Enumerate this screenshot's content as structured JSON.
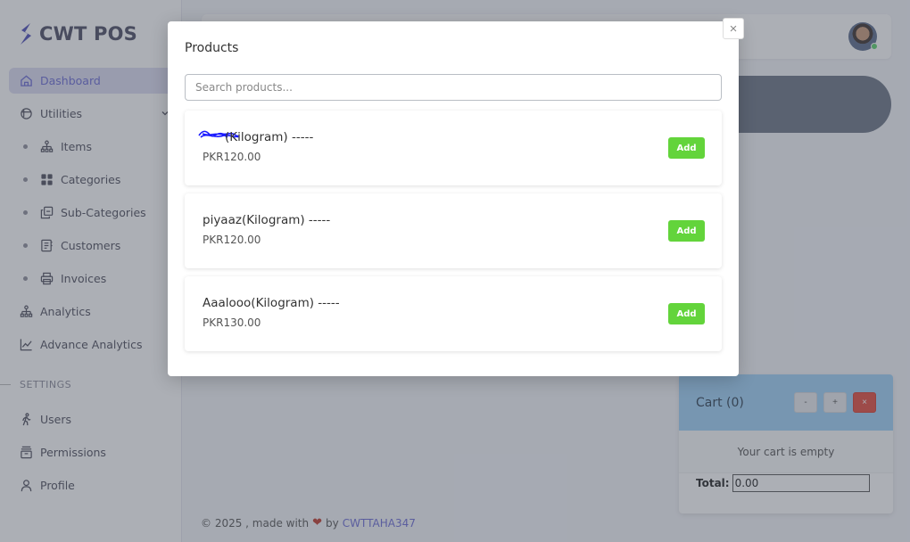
{
  "app": {
    "name": "CWT POS"
  },
  "sidebar": {
    "items": [
      {
        "label": "Dashboard",
        "icon": "home-icon",
        "active": true
      },
      {
        "label": "Utilities",
        "icon": "box-icon"
      },
      {
        "label": "Items",
        "icon": "sitemap-icon"
      },
      {
        "label": "Categories",
        "icon": "grid-icon"
      },
      {
        "label": "Sub-Categories",
        "icon": "copy-icon"
      },
      {
        "label": "Customers",
        "icon": "address-book-icon"
      },
      {
        "label": "Invoices",
        "icon": "printer-icon"
      },
      {
        "label": "Analytics",
        "icon": "sitemap-icon"
      },
      {
        "label": "Advance Analytics",
        "icon": "line-chart-icon"
      }
    ],
    "section_label": "SETTINGS",
    "settings_items": [
      {
        "label": "Users",
        "icon": "walking-user-icon"
      },
      {
        "label": "Permissions",
        "icon": "stack-icon"
      },
      {
        "label": "Profile",
        "icon": "user-icon"
      }
    ]
  },
  "cart": {
    "title": "Cart (0)",
    "minus_label": "-",
    "plus_label": "+",
    "clear_label": "×",
    "empty_text": "Your cart is empty",
    "total_label": "Total:",
    "total_value": "0.00"
  },
  "footer": {
    "prefix": "© 2025 , made with",
    "by": "by",
    "author": "CWTTAHA347"
  },
  "modal": {
    "title": "Products",
    "close_label": "×",
    "search_placeholder": "Search products...",
    "products": [
      {
        "name": "(Kilogram) -----",
        "price": "PKR120.00",
        "add_label": "Add"
      },
      {
        "name": "piyaaz(Kilogram) -----",
        "price": "PKR120.00",
        "add_label": "Add"
      },
      {
        "name": "Aaalooo(Kilogram) -----",
        "price": "PKR130.00",
        "add_label": "Add"
      }
    ]
  },
  "colors": {
    "accent": "#6b6bd6",
    "add_button": "#63d43b",
    "cart_header": "#9fd2f7",
    "clear_button": "#e3493b",
    "overlay": "#464e5c"
  }
}
